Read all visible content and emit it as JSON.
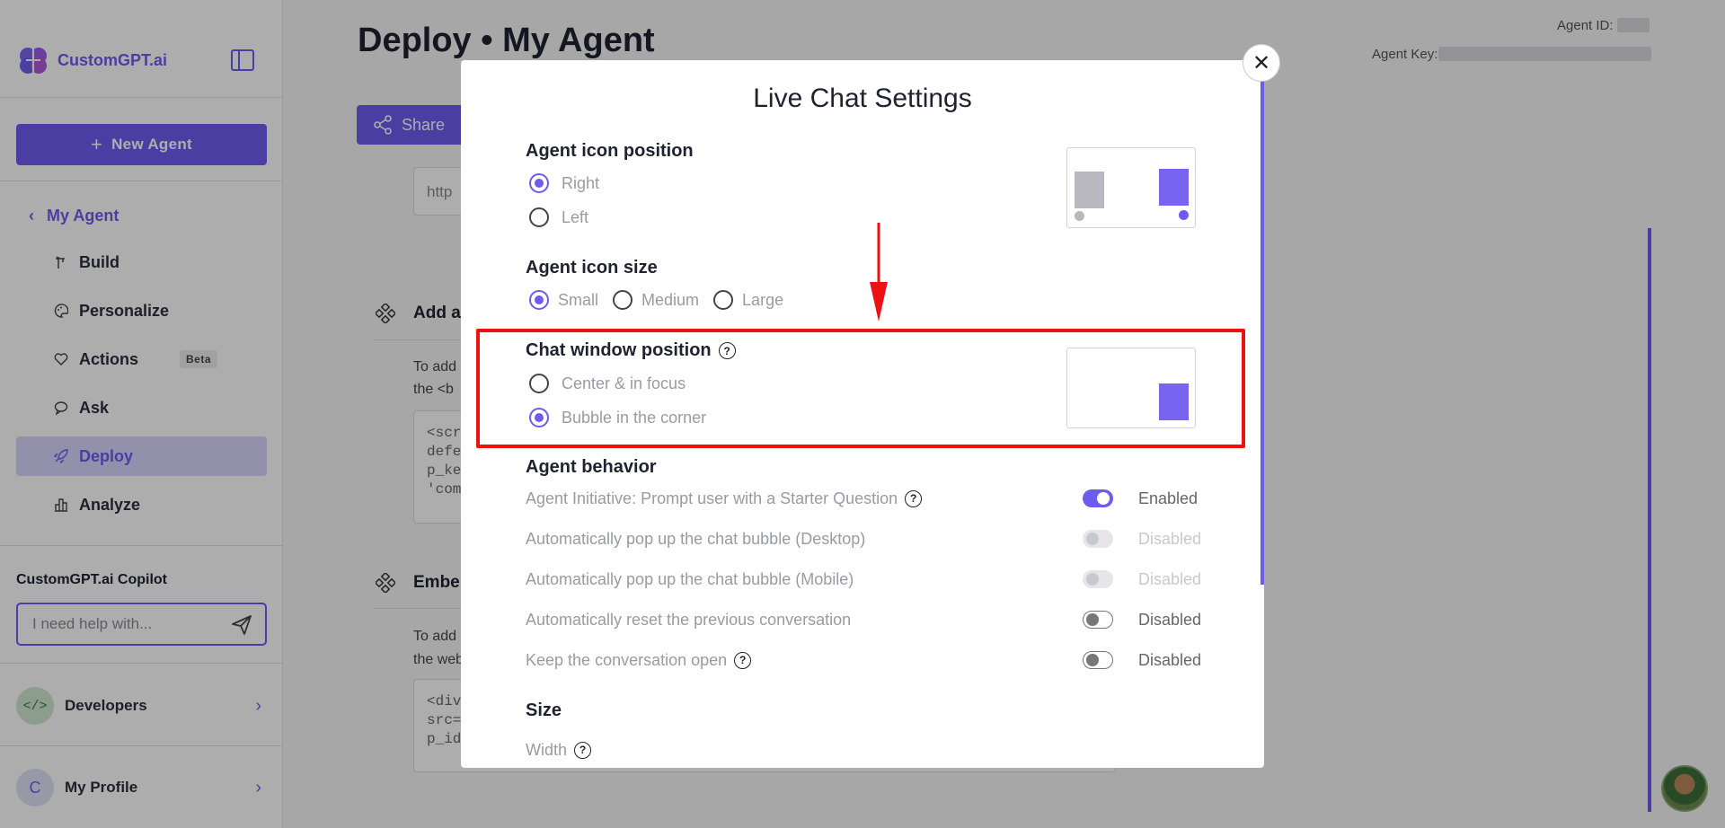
{
  "sidebar": {
    "logo_text": "CustomGPT.ai",
    "new_agent_label": "New Agent",
    "back_label": "My Agent",
    "items": [
      {
        "label": "Build",
        "icon": "build-icon"
      },
      {
        "label": "Personalize",
        "icon": "palette-icon"
      },
      {
        "label": "Actions",
        "icon": "actions-icon",
        "badge": "Beta"
      },
      {
        "label": "Ask",
        "icon": "chat-icon"
      },
      {
        "label": "Deploy",
        "icon": "rocket-icon",
        "active": true
      },
      {
        "label": "Analyze",
        "icon": "bar-chart-icon"
      }
    ],
    "copilot_title": "CustomGPT.ai Copilot",
    "copilot_placeholder": "I need help with...",
    "developers_label": "Developers",
    "profile_label": "My Profile",
    "profile_initial": "C"
  },
  "main": {
    "page_title": "Deploy • My Agent",
    "agent_id_label": "Agent ID:",
    "agent_key_label": "Agent Key:",
    "share_label": "Share",
    "url_stub": "http",
    "section1_heading": "Add a",
    "section1_text_1": "To add",
    "section1_text_2": "the <b",
    "section1_code": [
      "<scr",
      "defe",
      "p_ke",
      "'com"
    ],
    "section2_heading": "Embe",
    "section2_text_1": "To add",
    "section2_text_2": "the web",
    "section2_code": [
      "<div",
      "src=",
      "p_id"
    ]
  },
  "modal": {
    "title": "Live Chat Settings",
    "icon_position": {
      "label": "Agent icon position",
      "options": [
        {
          "label": "Right",
          "selected": true
        },
        {
          "label": "Left",
          "selected": false
        }
      ]
    },
    "icon_size": {
      "label": "Agent icon size",
      "options": [
        {
          "label": "Small",
          "selected": true
        },
        {
          "label": "Medium",
          "selected": false
        },
        {
          "label": "Large",
          "selected": false
        }
      ]
    },
    "chat_window": {
      "label": "Chat window position",
      "options": [
        {
          "label": "Center & in focus",
          "selected": false
        },
        {
          "label": "Bubble in the corner",
          "selected": true
        }
      ]
    },
    "behavior": {
      "label": "Agent behavior",
      "toggles": [
        {
          "label": "Agent Initiative: Prompt user with a Starter Question",
          "help": true,
          "state": "Enabled",
          "mode": "on"
        },
        {
          "label": "Automatically pop up the chat bubble (Desktop)",
          "help": false,
          "state": "Disabled",
          "mode": "dis"
        },
        {
          "label": "Automatically pop up the chat bubble (Mobile)",
          "help": false,
          "state": "Disabled",
          "mode": "dis"
        },
        {
          "label": "Automatically reset the previous conversation",
          "help": false,
          "state": "Disabled",
          "mode": "off"
        },
        {
          "label": "Keep the conversation open",
          "help": true,
          "state": "Disabled",
          "mode": "off"
        }
      ]
    },
    "size_label": "Size",
    "width_label": "Width"
  },
  "colors": {
    "accent": "#6d5cf0",
    "highlight": "#ee1111",
    "preview_inactive": "#b9b8c0"
  }
}
